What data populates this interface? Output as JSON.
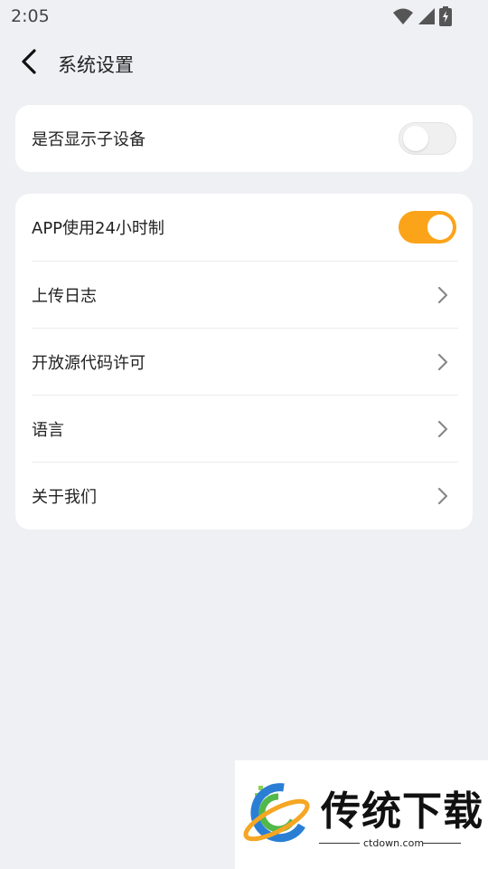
{
  "status_bar": {
    "time": "2:05"
  },
  "header": {
    "title": "系统设置"
  },
  "settings_group_1": [
    {
      "label": "是否显示子设备",
      "toggle": "off"
    }
  ],
  "settings_group_2": [
    {
      "label": "APP使用24小时制",
      "toggle": "on"
    },
    {
      "label": "上传日志"
    },
    {
      "label": "开放源代码许可"
    },
    {
      "label": "语言"
    },
    {
      "label": "关于我们"
    }
  ],
  "watermark": {
    "brand": "传统下载",
    "url": "ctdown.com"
  },
  "colors": {
    "accent": "#fba41a",
    "background": "#eff0f4",
    "card": "#ffffff"
  }
}
